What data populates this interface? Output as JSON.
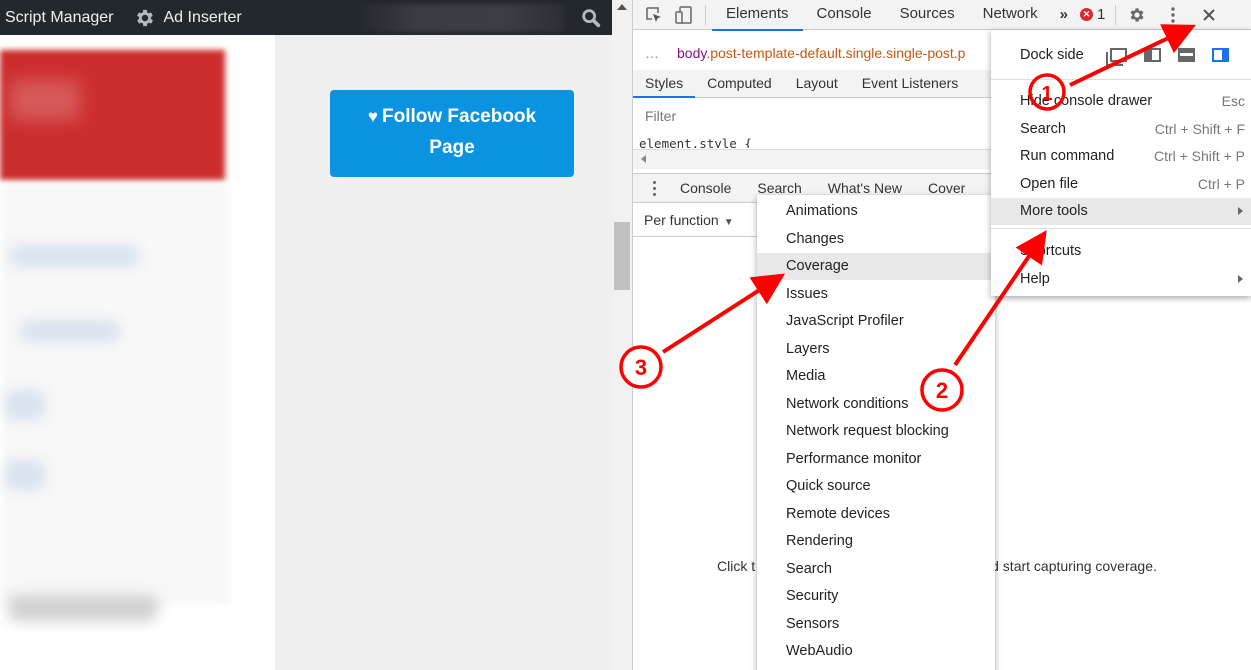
{
  "webpage": {
    "adminbar": {
      "items": [
        {
          "label": "Script Manager",
          "icon": null
        },
        {
          "label": "Ad Inserter",
          "icon": "gear-icon"
        }
      ],
      "search_icon": "search-icon"
    },
    "follow_button": {
      "icon": "heart-icon",
      "line1": "Follow Facebook",
      "line2": "Page",
      "color": "#0a93e0"
    },
    "accent_block_color": "#cc2d2d"
  },
  "devtools": {
    "toolbar": {
      "tabs": [
        "Elements",
        "Console",
        "Sources",
        "Network"
      ],
      "active_tab": "Elements",
      "more_tabs": "»",
      "error_count": "1",
      "icons": [
        "inspect-element-icon",
        "device-toolbar-icon",
        "settings-gear-icon",
        "kebab-menu-icon",
        "close-icon"
      ]
    },
    "breadcrumb": {
      "ellipsis": "…",
      "tag": "body",
      "classes": ".post-template-default.single.single-post.p"
    },
    "styles_tabs": [
      "Styles",
      "Computed",
      "Layout",
      "Event Listeners"
    ],
    "styles_active": "Styles",
    "filter_placeholder": "Filter",
    "code_line": "element.style {",
    "drawer_tabs": [
      "Console",
      "Search",
      "What's New",
      "Cover"
    ],
    "coverage": {
      "mode": "Per function",
      "hint_start": "Click t",
      "hint_end": "d start capturing coverage."
    }
  },
  "main_menu": {
    "dock_label": "Dock side",
    "dock_options": [
      "undock",
      "dock-left",
      "dock-bottom",
      "dock-right"
    ],
    "dock_selected": "dock-right",
    "items": [
      {
        "label": "Hide console drawer",
        "shortcut": "Esc"
      },
      {
        "label": "Search",
        "shortcut": "Ctrl + Shift + F"
      },
      {
        "label": "Run command",
        "shortcut": "Ctrl + Shift + P"
      },
      {
        "label": "Open file",
        "shortcut": "Ctrl + P"
      },
      {
        "label": "More tools",
        "submenu": true,
        "highlighted": true
      },
      {
        "label": "Shortcuts",
        "shortcut": ""
      },
      {
        "label": "Help",
        "submenu": true
      }
    ]
  },
  "more_tools_menu": {
    "items": [
      "Animations",
      "Changes",
      "Coverage",
      "Issues",
      "JavaScript Profiler",
      "Layers",
      "Media",
      "Network conditions",
      "Network request blocking",
      "Performance monitor",
      "Quick source",
      "Remote devices",
      "Rendering",
      "Search",
      "Security",
      "Sensors",
      "WebAudio"
    ],
    "highlighted": "Coverage"
  },
  "annotations": {
    "color": "#ff0000",
    "steps": [
      {
        "number": "1",
        "target": "kebab-menu-icon"
      },
      {
        "number": "2",
        "target": "More tools"
      },
      {
        "number": "3",
        "target": "Coverage"
      }
    ]
  }
}
